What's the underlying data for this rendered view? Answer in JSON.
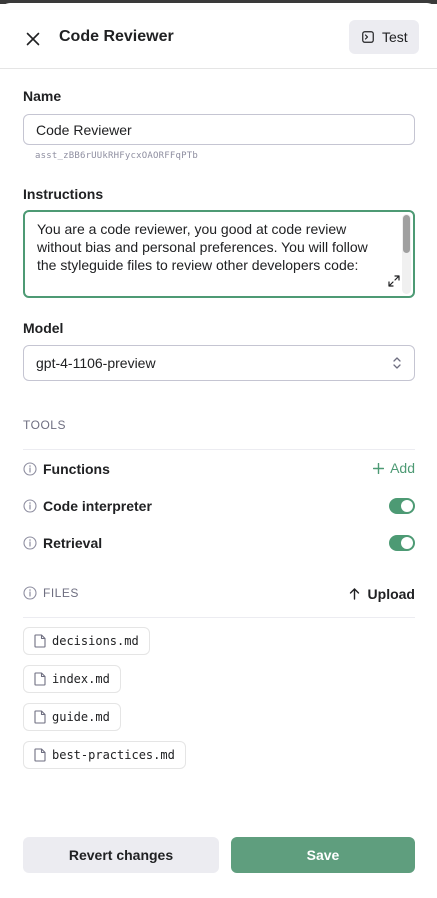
{
  "header": {
    "title": "Code Reviewer",
    "test_label": "Test"
  },
  "name": {
    "label": "Name",
    "value": "Code Reviewer",
    "assistant_id": "asst_zBB6rUUkRHFycxOAORFFqPTb"
  },
  "instructions": {
    "label": "Instructions",
    "text": "You are a code reviewer, you good at code review without bias and personal preferences. You will follow the styleguide files to review other developers code:"
  },
  "model": {
    "label": "Model",
    "selected": "gpt-4-1106-preview"
  },
  "tools": {
    "heading": "TOOLS",
    "items": [
      {
        "label": "Functions",
        "action": "Add"
      },
      {
        "label": "Code interpreter",
        "enabled": true
      },
      {
        "label": "Retrieval",
        "enabled": true
      }
    ]
  },
  "files": {
    "heading": "FILES",
    "upload_label": "Upload",
    "items": [
      "decisions.md",
      "index.md",
      "guide.md",
      "best-practices.md"
    ]
  },
  "footer": {
    "revert_label": "Revert changes",
    "save_label": "Save"
  },
  "colors": {
    "accent": "#4d9a74",
    "save_button": "#5f9e7e",
    "secondary_button": "#ececf1"
  }
}
